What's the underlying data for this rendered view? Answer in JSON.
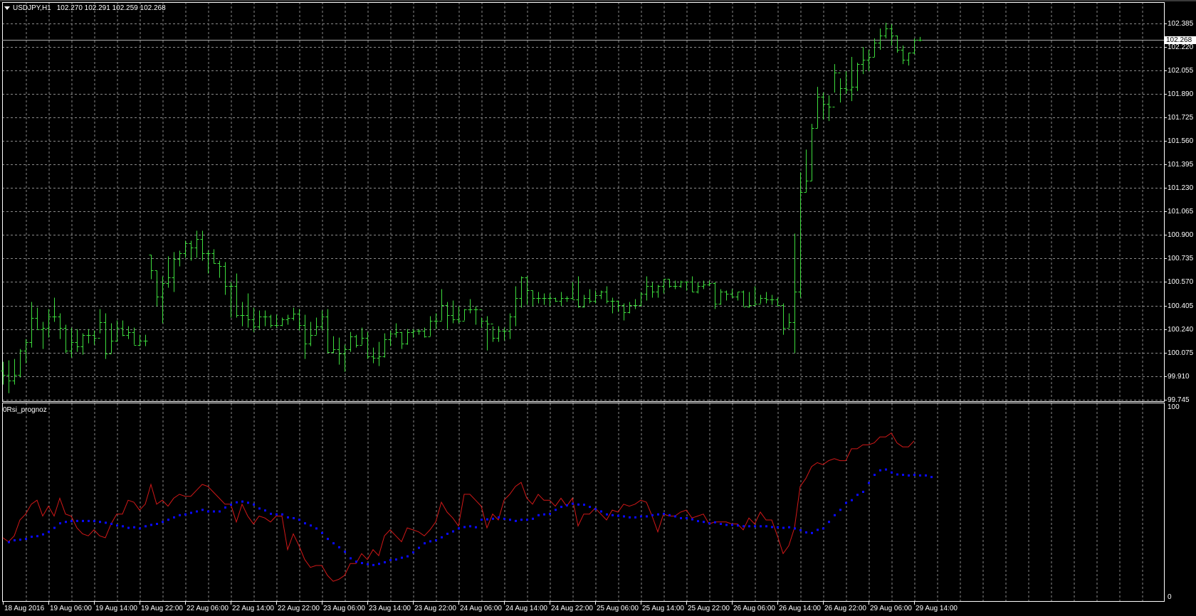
{
  "header": {
    "symbol": "USDJPY,H1",
    "ohlc": "102.270 102.291 102.259 102.268"
  },
  "indicator": {
    "name": "0Rsi_prognoz",
    "scale_max": "100",
    "scale_min": "0"
  },
  "current_price": "102.268",
  "colors": {
    "bars": "#3ddc3d",
    "grid": "#8a8a8a",
    "rsi": "#d01818",
    "signal": "#0a0aff",
    "price_line": "#a8a8a8"
  },
  "price_axis": [
    "102.385",
    "102.220",
    "102.055",
    "101.890",
    "101.725",
    "101.560",
    "101.395",
    "101.230",
    "101.065",
    "100.900",
    "100.735",
    "100.570",
    "100.405",
    "100.240",
    "100.075",
    "99.910",
    "99.745"
  ],
  "time_axis": [
    "18 Aug 2016",
    "19 Aug 06:00",
    "19 Aug 14:00",
    "19 Aug 22:00",
    "22 Aug 06:00",
    "22 Aug 14:00",
    "22 Aug 22:00",
    "23 Aug 06:00",
    "23 Aug 14:00",
    "23 Aug 22:00",
    "24 Aug 06:00",
    "24 Aug 14:00",
    "24 Aug 22:00",
    "25 Aug 06:00",
    "25 Aug 14:00",
    "25 Aug 22:00",
    "26 Aug 06:00",
    "26 Aug 14:00",
    "26 Aug 22:00",
    "29 Aug 06:00",
    "29 Aug 14:00"
  ],
  "chart_data": {
    "type": "ohlc",
    "symbol": "USDJPY",
    "timeframe": "H1",
    "ylim": [
      99.745,
      102.385
    ],
    "first_open": 99.95,
    "bars_hlc": [
      [
        100.01,
        99.85,
        99.92
      ],
      [
        100.02,
        99.79,
        99.88
      ],
      [
        100.03,
        99.85,
        99.92
      ],
      [
        100.1,
        99.9,
        100.09
      ],
      [
        100.17,
        100.0,
        100.15
      ],
      [
        100.43,
        100.11,
        100.32
      ],
      [
        100.39,
        100.24,
        100.24
      ],
      [
        100.29,
        100.1,
        100.25
      ],
      [
        100.38,
        100.18,
        100.33
      ],
      [
        100.46,
        100.29,
        100.33
      ],
      [
        100.35,
        100.17,
        100.25
      ],
      [
        100.27,
        100.07,
        100.09
      ],
      [
        100.25,
        100.04,
        100.15
      ],
      [
        100.24,
        100.08,
        100.12
      ],
      [
        100.21,
        100.06,
        100.2
      ],
      [
        100.24,
        100.14,
        100.2
      ],
      [
        100.23,
        100.13,
        100.18
      ],
      [
        100.38,
        100.21,
        100.29
      ],
      [
        100.35,
        100.03,
        100.07
      ],
      [
        100.28,
        100.07,
        100.16
      ],
      [
        100.3,
        100.15,
        100.25
      ],
      [
        100.3,
        100.19,
        100.2
      ],
      [
        100.26,
        100.17,
        100.22
      ],
      [
        100.25,
        100.13,
        100.13
      ],
      [
        100.2,
        100.12,
        100.16
      ],
      [
        100.2,
        100.12,
        100.16
      ],
      [
        100.76,
        100.59,
        100.65,
        100.76
      ],
      [
        100.65,
        100.4,
        100.47
      ],
      [
        100.61,
        100.28,
        100.56
      ],
      [
        100.75,
        100.53,
        100.6
      ],
      [
        100.78,
        100.5,
        100.73
      ],
      [
        100.79,
        100.68,
        100.77
      ],
      [
        100.86,
        100.74,
        100.84
      ],
      [
        100.86,
        100.72,
        100.81
      ],
      [
        100.93,
        100.74,
        100.87
      ],
      [
        100.93,
        100.72,
        100.77
      ],
      [
        100.79,
        100.63,
        100.77
      ],
      [
        100.8,
        100.7,
        100.7
      ],
      [
        100.72,
        100.6,
        100.68
      ],
      [
        100.71,
        100.48,
        100.54
      ],
      [
        100.57,
        100.32,
        100.54
      ],
      [
        100.63,
        100.32,
        100.34
      ],
      [
        100.43,
        100.26,
        100.34
      ],
      [
        100.49,
        100.25,
        100.31
      ],
      [
        100.39,
        100.22,
        100.26
      ],
      [
        100.37,
        100.24,
        100.33
      ],
      [
        100.37,
        100.26,
        100.33
      ],
      [
        100.34,
        100.25,
        100.27
      ],
      [
        100.34,
        100.25,
        100.27
      ],
      [
        100.32,
        100.26,
        100.31
      ],
      [
        100.34,
        100.27,
        100.32
      ],
      [
        100.39,
        100.3,
        100.35
      ],
      [
        100.38,
        100.23,
        100.27
      ],
      [
        100.34,
        100.03,
        100.14
      ],
      [
        100.29,
        100.12,
        100.2
      ],
      [
        100.32,
        100.2,
        100.26
      ],
      [
        100.37,
        100.23,
        100.33
      ],
      [
        100.38,
        100.07,
        100.08
      ],
      [
        100.19,
        100.07,
        100.1
      ],
      [
        100.18,
        99.99,
        100.07
      ],
      [
        100.13,
        99.94,
        100.1
      ],
      [
        100.22,
        100.08,
        100.19
      ],
      [
        100.2,
        100.11,
        100.13
      ],
      [
        100.25,
        100.13,
        100.18
      ],
      [
        100.22,
        100.03,
        100.05
      ],
      [
        100.11,
        100.0,
        100.04
      ],
      [
        100.15,
        99.98,
        100.05
      ],
      [
        100.21,
        100.04,
        100.17
      ],
      [
        100.23,
        100.12,
        100.21
      ],
      [
        100.28,
        100.18,
        100.22
      ],
      [
        100.22,
        100.1,
        100.14
      ],
      [
        100.24,
        100.13,
        100.22
      ],
      [
        100.24,
        100.18,
        100.23
      ],
      [
        100.24,
        100.2,
        100.23
      ],
      [
        100.25,
        100.18,
        100.19
      ],
      [
        100.33,
        100.19,
        100.3
      ],
      [
        100.35,
        100.24,
        100.3
      ],
      [
        100.52,
        100.3,
        100.41
      ],
      [
        100.43,
        100.24,
        100.34
      ],
      [
        100.44,
        100.28,
        100.31
      ],
      [
        100.4,
        100.28,
        100.3
      ],
      [
        100.38,
        100.3,
        100.38
      ],
      [
        100.45,
        100.35,
        100.38
      ],
      [
        100.4,
        100.27,
        100.38
      ],
      [
        100.32,
        100.25,
        100.3
      ],
      [
        100.33,
        100.09,
        100.28
      ],
      [
        100.26,
        100.15,
        100.18
      ],
      [
        100.26,
        100.15,
        100.23
      ],
      [
        100.25,
        100.16,
        100.23
      ],
      [
        100.35,
        100.17,
        100.33
      ],
      [
        100.54,
        100.26,
        100.46
      ],
      [
        100.61,
        100.39,
        100.6
      ],
      [
        100.61,
        100.41,
        100.51
      ],
      [
        100.51,
        100.4,
        100.46
      ],
      [
        100.5,
        100.42,
        100.46
      ],
      [
        100.49,
        100.41,
        100.46
      ],
      [
        100.49,
        100.4,
        100.46
      ],
      [
        100.46,
        100.43,
        100.44
      ],
      [
        100.5,
        100.4,
        100.46
      ],
      [
        100.47,
        100.43,
        100.46
      ],
      [
        100.57,
        100.45,
        100.45
      ],
      [
        100.61,
        100.39,
        100.4
      ],
      [
        100.48,
        100.39,
        100.46
      ],
      [
        100.52,
        100.42,
        100.44
      ],
      [
        100.51,
        100.42,
        100.48
      ],
      [
        100.51,
        100.45,
        100.5
      ],
      [
        100.54,
        100.42,
        100.44
      ],
      [
        100.46,
        100.35,
        100.44
      ],
      [
        100.44,
        100.36,
        100.41
      ],
      [
        100.42,
        100.3,
        100.36
      ],
      [
        100.43,
        100.35,
        100.41
      ],
      [
        100.45,
        100.38,
        100.41
      ],
      [
        100.5,
        100.4,
        100.49
      ],
      [
        100.61,
        100.44,
        100.54
      ],
      [
        100.57,
        100.46,
        100.5
      ],
      [
        100.55,
        100.46,
        100.54
      ],
      [
        100.59,
        100.49,
        100.59
      ],
      [
        100.59,
        100.53,
        100.54
      ],
      [
        100.58,
        100.52,
        100.54
      ],
      [
        100.58,
        100.53,
        100.57
      ],
      [
        100.57,
        100.51,
        100.57
      ],
      [
        100.61,
        100.5,
        100.5
      ],
      [
        100.57,
        100.49,
        100.54
      ],
      [
        100.58,
        100.52,
        100.55
      ],
      [
        100.58,
        100.54,
        100.56
      ],
      [
        100.57,
        100.38,
        100.42
      ],
      [
        100.52,
        100.41,
        100.5
      ],
      [
        100.51,
        100.44,
        100.49
      ],
      [
        100.52,
        100.46,
        100.47
      ],
      [
        100.5,
        100.44,
        100.5
      ],
      [
        100.51,
        100.4,
        100.4
      ],
      [
        100.5,
        100.39,
        100.41
      ],
      [
        100.54,
        100.41,
        100.42
      ],
      [
        100.48,
        100.42,
        100.46
      ],
      [
        100.5,
        100.42,
        100.45
      ],
      [
        100.48,
        100.41,
        100.45
      ],
      [
        100.46,
        100.4,
        100.41
      ],
      [
        100.42,
        100.2,
        100.25
      ],
      [
        100.35,
        100.25,
        100.29
      ],
      [
        100.91,
        100.07,
        100.5
      ],
      [
        101.34,
        100.46,
        101.2
      ],
      [
        101.5,
        101.2,
        101.28
      ],
      [
        101.68,
        101.28,
        101.65
      ],
      [
        101.94,
        101.65,
        101.87
      ],
      [
        101.9,
        101.71,
        101.82
      ],
      [
        101.88,
        101.7,
        101.8
      ],
      [
        102.1,
        101.9,
        102.04
      ],
      [
        102.0,
        101.83,
        101.93
      ],
      [
        102.05,
        101.89,
        101.92
      ],
      [
        102.15,
        101.84,
        101.94
      ],
      [
        102.11,
        101.91,
        102.1
      ],
      [
        102.22,
        102.03,
        102.13
      ],
      [
        102.2,
        102.05,
        102.15
      ],
      [
        102.28,
        102.15,
        102.25
      ],
      [
        102.35,
        102.2,
        102.3
      ],
      [
        102.39,
        102.28,
        102.35
      ],
      [
        102.38,
        102.23,
        102.3
      ],
      [
        102.3,
        102.18,
        102.2
      ],
      [
        102.23,
        102.1,
        102.13
      ],
      [
        102.18,
        102.09,
        102.18
      ],
      [
        102.28,
        102.17,
        102.27
      ],
      [
        102.291,
        102.259,
        102.268,
        102.27
      ]
    ],
    "rsi_ylim": [
      0,
      100
    ],
    "rsi": [
      32,
      30,
      33,
      41,
      44,
      49,
      51,
      43,
      48,
      43,
      52,
      44,
      43,
      37,
      34,
      33,
      36,
      33,
      32,
      39,
      44,
      44,
      51,
      50,
      46,
      49,
      59,
      49,
      51,
      48,
      52,
      54,
      53,
      53,
      56,
      59,
      58,
      55,
      52,
      49,
      49,
      40,
      49,
      43,
      39,
      43,
      42,
      40,
      43,
      43,
      26,
      34,
      28,
      21,
      17,
      18,
      18,
      13,
      10,
      11,
      13,
      19,
      19,
      24,
      21,
      26,
      23,
      33,
      36,
      33,
      30,
      37,
      36,
      35,
      33,
      36,
      40,
      50,
      45,
      42,
      38,
      54,
      54,
      51,
      48,
      37,
      44,
      41,
      51,
      54,
      58,
      60,
      52,
      49,
      54,
      51,
      51,
      48,
      52,
      48,
      52,
      38,
      44,
      44,
      47,
      44,
      41,
      46,
      45,
      49,
      48,
      49,
      51,
      50,
      43,
      35,
      44,
      43,
      43,
      45,
      46,
      42,
      43,
      44,
      39,
      40,
      40,
      40,
      39,
      39,
      36,
      42,
      39,
      45,
      41,
      41,
      33,
      24,
      28,
      37,
      58,
      62,
      68,
      70,
      69,
      71,
      72,
      71,
      71,
      77,
      77,
      79,
      79,
      80,
      83,
      83,
      85,
      80,
      78,
      78,
      81
    ],
    "signal_start_bar": 1,
    "signal": [
      30.0,
      30.9,
      31.2,
      31.6,
      32.7,
      33.0,
      33.9,
      35.2,
      37.2,
      39.5,
      40.2,
      40.6,
      40.7,
      40.7,
      40.7,
      40.6,
      40.2,
      39.8,
      39.2,
      38.4,
      38.0,
      37.2,
      37.5,
      36.9,
      38.0,
      38.7,
      39.2,
      40.2,
      41.3,
      42.5,
      43.6,
      44.0,
      44.8,
      45.5,
      46.3,
      45.5,
      45.5,
      45.5,
      47.5,
      48.9,
      50.1,
      50.5,
      49.9,
      49.0,
      47.0,
      46.0,
      44.3,
      44.0,
      44.0,
      42.5,
      42.1,
      41.3,
      39.5,
      38.4,
      36.9,
      34.6,
      31.6,
      29.4,
      27.4,
      25.1,
      21.8,
      20.1,
      19.4,
      18.8,
      18.4,
      19.0,
      19.8,
      20.9,
      21.2,
      22.1,
      22.8,
      24.8,
      27.1,
      29.4,
      30.4,
      30.9,
      32.4,
      34.2,
      35.4,
      36.9,
      37.6,
      38.0,
      37.5,
      41.3,
      41.5,
      41.8,
      42.5,
      41.8,
      41.3,
      40.7,
      41.3,
      41.3,
      41.8,
      43.6,
      44.0,
      44.3,
      46.3,
      47.8,
      48.6,
      49.4,
      49.0,
      48.9,
      47.8,
      46.7,
      45.5,
      44.0,
      43.6,
      43.3,
      43.0,
      42.5,
      42.5,
      43.0,
      43.0,
      43.6,
      44.0,
      44.3,
      43.6,
      43.0,
      42.1,
      42.1,
      41.5,
      40.6,
      40.2,
      39.5,
      40.0,
      39.2,
      38.7,
      38.7,
      38.4,
      38.0,
      38.0,
      38.0,
      38.0,
      38.0,
      37.6,
      37.5,
      37.2,
      37.5,
      36.9,
      36.0,
      34.9,
      34.6,
      36.2,
      36.9,
      40.2,
      43.6,
      46.3,
      49.8,
      51.2,
      53.9,
      55.4,
      59.9,
      64.0,
      66.3,
      66.7,
      65.2,
      64.2,
      64.0,
      63.7,
      64.0,
      63.7,
      63.7,
      62.9
    ]
  }
}
